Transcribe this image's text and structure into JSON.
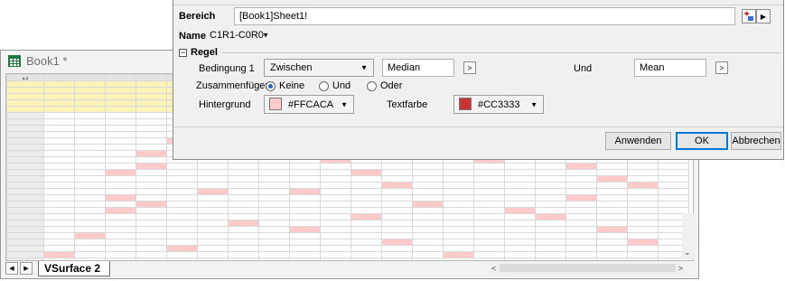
{
  "book": {
    "title": "Book1 *",
    "corner_label": "A-Z",
    "sheet_tab": "VSurface 2",
    "highlight_color": "#FFCACA",
    "text_color": "#CC3333"
  },
  "dialog": {
    "bereich_label": "Bereich",
    "bereich_value": "[Book1]Sheet1!",
    "name_label": "Name",
    "name_value": "C1R1-C0R0",
    "regel_label": "Regel",
    "bedingung_label": "Bedingung 1",
    "bedingung_value": "Zwischen",
    "median_value": "Median",
    "und_label": "Und",
    "mean_value": "Mean",
    "zusammen_label": "Zusammenfügen",
    "radio_options": [
      "Keine",
      "Und",
      "Oder"
    ],
    "radio_selected": "Keine",
    "hintergrund_label": "Hintergrund",
    "hintergrund_value": "#FFCACA",
    "textfarbe_label": "Textfarbe",
    "textfarbe_value": "#CC3333",
    "buttons": {
      "apply": "Anwenden",
      "ok": "OK",
      "cancel": "Abbrechen"
    }
  }
}
